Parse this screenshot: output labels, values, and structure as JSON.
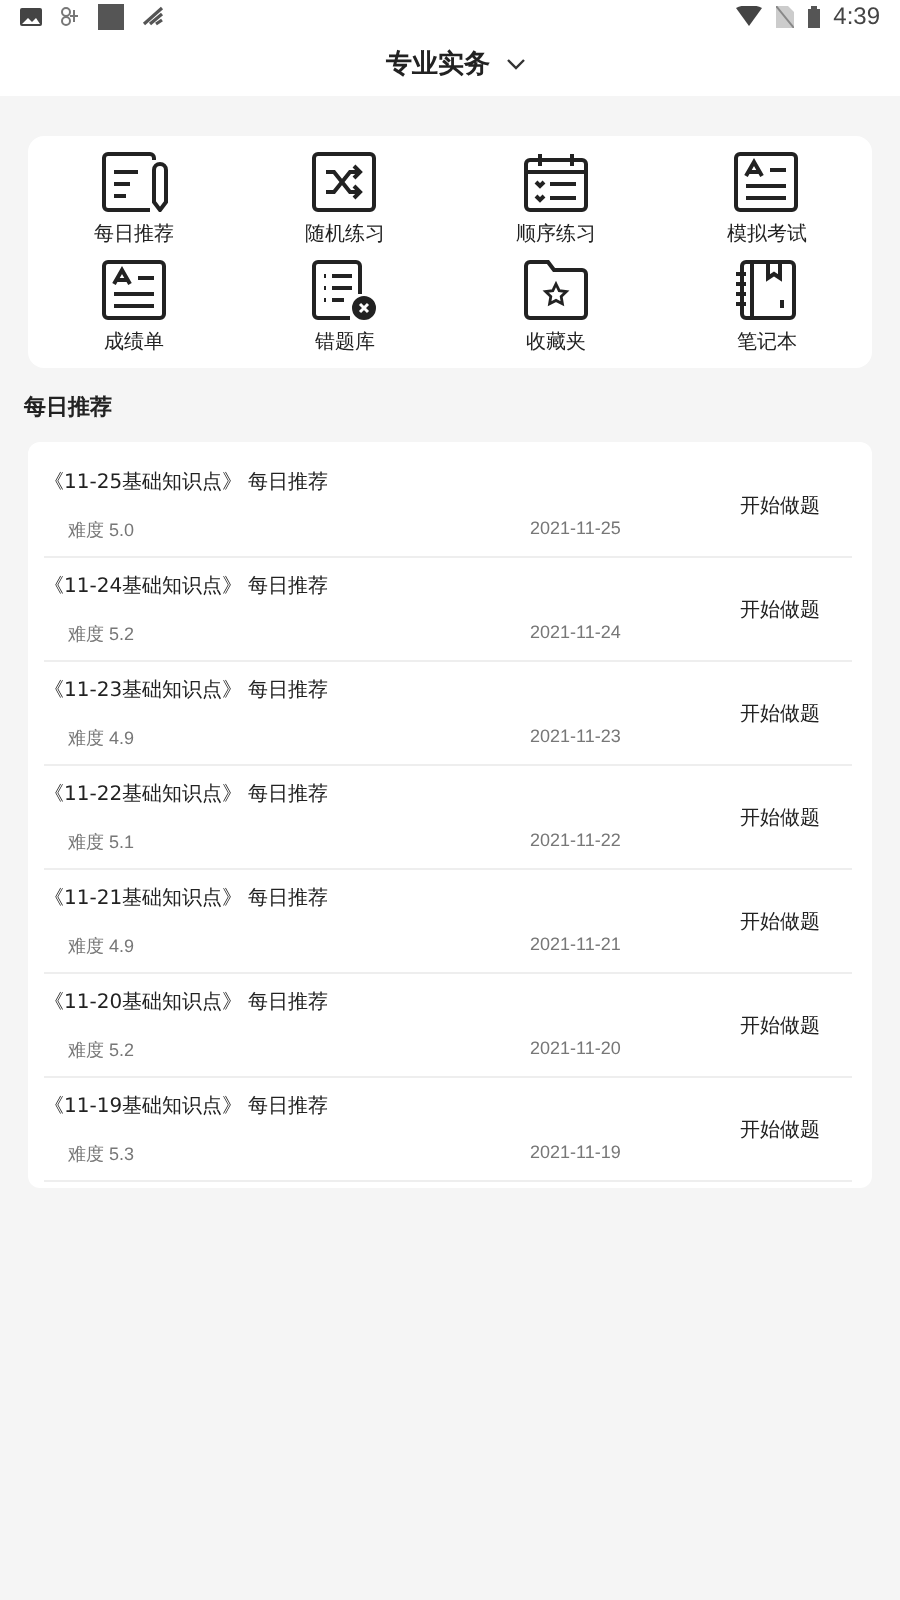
{
  "status_bar": {
    "time": "4:39"
  },
  "header": {
    "title": "专业实务"
  },
  "menu": [
    {
      "label": "每日推荐",
      "kind": "pen-note"
    },
    {
      "label": "随机练习",
      "kind": "shuffle"
    },
    {
      "label": "顺序练习",
      "kind": "calendar"
    },
    {
      "label": "模拟考试",
      "kind": "exam"
    },
    {
      "label": "成绩单",
      "kind": "exam"
    },
    {
      "label": "错题库",
      "kind": "list-error"
    },
    {
      "label": "收藏夹",
      "kind": "folder-star"
    },
    {
      "label": "笔记本",
      "kind": "notebook"
    }
  ],
  "section_title": "每日推荐",
  "items": [
    {
      "title": "《11-25基础知识点》 每日推荐",
      "difficulty": "难度 5.0",
      "date": "2021-11-25",
      "action": "开始做题"
    },
    {
      "title": "《11-24基础知识点》 每日推荐",
      "difficulty": "难度 5.2",
      "date": "2021-11-24",
      "action": "开始做题"
    },
    {
      "title": "《11-23基础知识点》 每日推荐",
      "difficulty": "难度 4.9",
      "date": "2021-11-23",
      "action": "开始做题"
    },
    {
      "title": "《11-22基础知识点》 每日推荐",
      "difficulty": "难度 5.1",
      "date": "2021-11-22",
      "action": "开始做题"
    },
    {
      "title": "《11-21基础知识点》 每日推荐",
      "difficulty": "难度 4.9",
      "date": "2021-11-21",
      "action": "开始做题"
    },
    {
      "title": "《11-20基础知识点》 每日推荐",
      "difficulty": "难度 5.2",
      "date": "2021-11-20",
      "action": "开始做题"
    },
    {
      "title": "《11-19基础知识点》 每日推荐",
      "difficulty": "难度 5.3",
      "date": "2021-11-19",
      "action": "开始做题"
    }
  ]
}
